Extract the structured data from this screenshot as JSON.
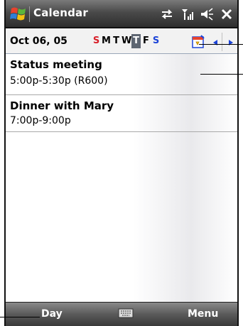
{
  "titlebar": {
    "app_title": "Calendar",
    "icons": [
      "windows-start-flag-icon",
      "connectivity-icon",
      "signal-icon",
      "volume-icon",
      "close-icon"
    ]
  },
  "datebar": {
    "date": "Oct 06, 05",
    "weekdays": [
      "S",
      "M",
      "T",
      "W",
      "T",
      "F",
      "S"
    ],
    "selected_weekday_index": 4,
    "icons": [
      "go-to-today-icon",
      "previous-arrow-icon",
      "next-arrow-icon"
    ]
  },
  "appointments": [
    {
      "subject": "Status meeting",
      "time": "5:00p-5:30p (R600)"
    },
    {
      "subject": "Dinner with Mary",
      "time": "7:00p-9:00p"
    }
  ],
  "menubar": {
    "left_softkey": "Day",
    "right_softkey": "Menu",
    "icons": [
      "keyboard-icon"
    ]
  },
  "colors": {
    "weekend_sunday": "#d8202a",
    "weekend_saturday": "#1c44d8",
    "selected_day_bg": "#5e6672",
    "bar_dark": "#3a3a3a"
  }
}
